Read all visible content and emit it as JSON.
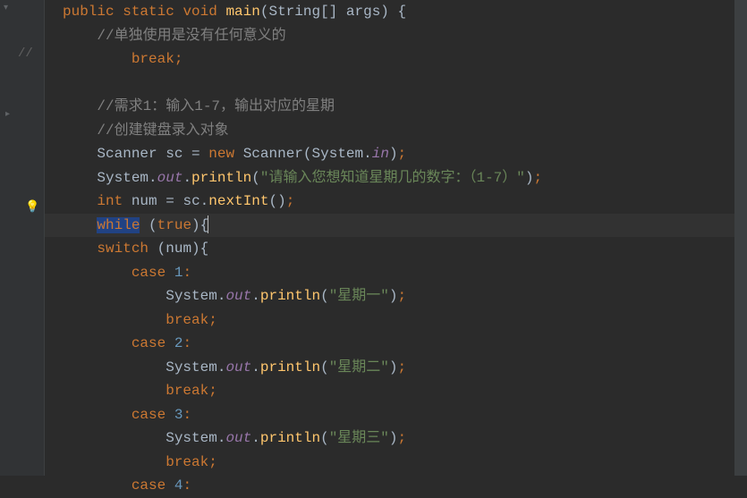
{
  "code": {
    "line1": {
      "kw_public": "public",
      "kw_static": "static",
      "kw_void": "void",
      "fn_main": "main",
      "type_string": "String",
      "param": "args",
      "brackets": "[]"
    },
    "line2_comment": "//单独使用是没有任何意义的",
    "line3_break": "break",
    "line5_comment": "//需求1：输入1-7，输出对应的星期",
    "line6_comment": "//创建键盘录入对象",
    "line7": {
      "scanner": "Scanner",
      "sc": "sc",
      "eq": "=",
      "new": "new",
      "scanner2": "Scanner",
      "system": "System",
      "in": "in"
    },
    "line8": {
      "system": "System",
      "out": "out",
      "println": "println",
      "str": "\"请输入您想知道星期几的数字：（1-7）\""
    },
    "line9": {
      "int": "int",
      "num": "num",
      "eq": "=",
      "sc": "sc",
      "nextInt": "nextInt"
    },
    "line10": {
      "while": "while",
      "true": "true"
    },
    "line11": {
      "switch": "switch",
      "num": "num"
    },
    "case1": {
      "case": "case",
      "num": "1",
      "system": "System",
      "out": "out",
      "println": "println",
      "str": "\"星期一\"",
      "break": "break"
    },
    "case2": {
      "case": "case",
      "num": "2",
      "system": "System",
      "out": "out",
      "println": "println",
      "str": "\"星期二\"",
      "break": "break"
    },
    "case3": {
      "case": "case",
      "num": "3",
      "system": "System",
      "out": "out",
      "println": "println",
      "str": "\"星期三\"",
      "break": "break"
    },
    "case4": {
      "case": "case",
      "num": "4"
    }
  },
  "gutter": {
    "tick": "//",
    "bulb": "💡"
  }
}
